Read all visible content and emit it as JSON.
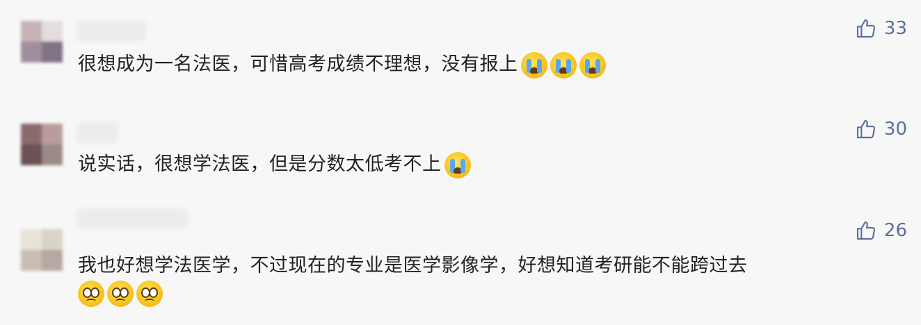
{
  "comments": [
    {
      "text": "很想成为一名法医，可惜高考成绩不理想，没有报上",
      "likes": "33",
      "emoji": "crying-face",
      "emoji_count": 3,
      "avatar_colors": [
        "#c9b2b6",
        "#e4dde0",
        "#9f8e9c",
        "#7f7385"
      ]
    },
    {
      "text": "说实话，很想学法医，但是分数太低考不上",
      "likes": "30",
      "emoji": "crying-face",
      "emoji_count": 1,
      "avatar_colors": [
        "#8a6b6d",
        "#b99c9b",
        "#6c5256",
        "#9c8a86"
      ]
    },
    {
      "text": "我也好想学法医学，不过现在的专业是医学影像学，好想知道考研能不能跨过去",
      "likes": "26",
      "emoji": "pleading-face",
      "emoji_count": 3,
      "avatar_colors": [
        "#e8e3d8",
        "#d9d4c6",
        "#c8bdb3",
        "#b7a8a3"
      ]
    }
  ],
  "colors": {
    "like": "#5b6f9c",
    "text": "#222222",
    "background": "#f7f7f7"
  }
}
